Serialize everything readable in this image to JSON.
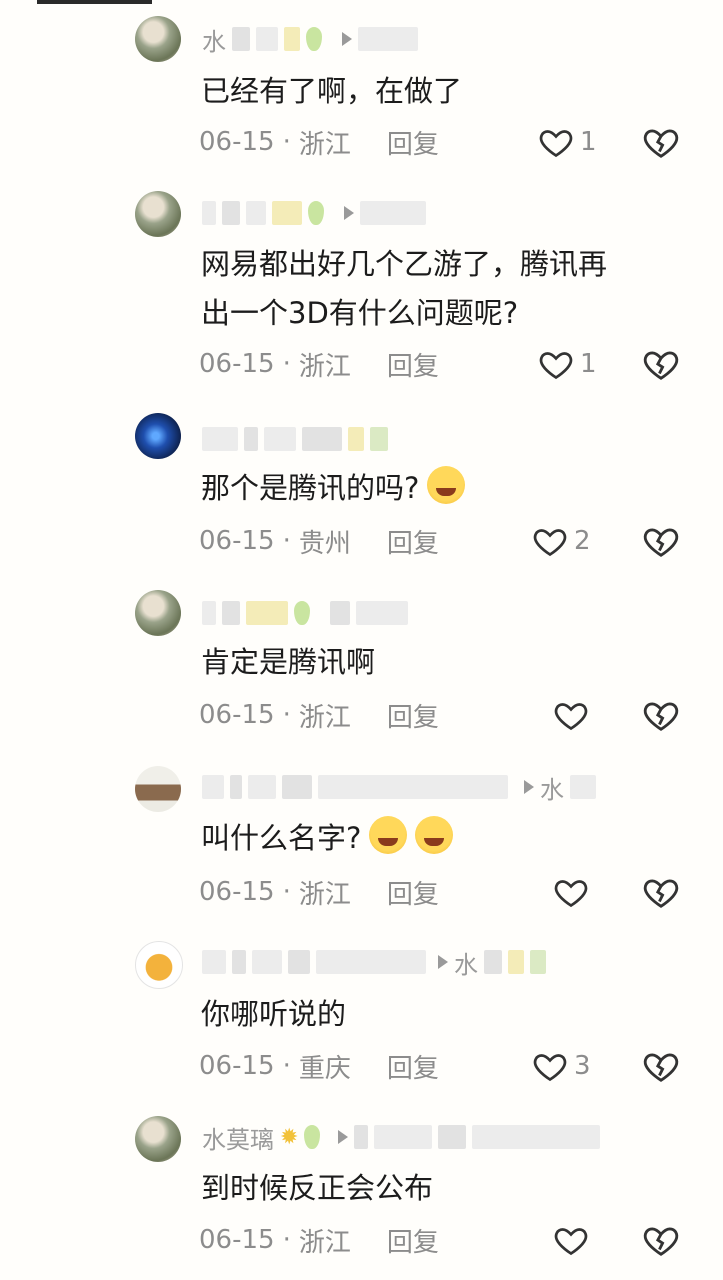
{
  "comments": [
    {
      "username": "水",
      "text": "已经有了啊，在做了",
      "date": "06-15",
      "location": "浙江",
      "reply_label": "回复",
      "likes": "1"
    },
    {
      "text_line1": "网易都出好几个乙游了，腾讯再",
      "text_line2": "出一个3D有什么问题呢?",
      "date": "06-15",
      "location": "浙江",
      "reply_label": "回复",
      "likes": "1"
    },
    {
      "text": "那个是腾讯的吗?",
      "date": "06-15",
      "location": "贵州",
      "reply_label": "回复",
      "likes": "2"
    },
    {
      "text": "肯定是腾讯啊",
      "date": "06-15",
      "location": "浙江",
      "reply_label": "回复"
    },
    {
      "target_username": "水",
      "text": "叫什么名字?",
      "date": "06-15",
      "location": "浙江",
      "reply_label": "回复"
    },
    {
      "target_username": "水",
      "text": "你哪听说的",
      "date": "06-15",
      "location": "重庆",
      "reply_label": "回复",
      "likes": "3"
    },
    {
      "username": "水莫璃",
      "text": "到时候反正会公布",
      "date": "06-15",
      "location": "浙江",
      "reply_label": "回复"
    }
  ],
  "common": {
    "dot": "·"
  },
  "icons": [
    "heart-icon",
    "broken-heart-icon",
    "reply-arrow-icon",
    "pear-emoji-icon",
    "sun-emoji-icon"
  ]
}
